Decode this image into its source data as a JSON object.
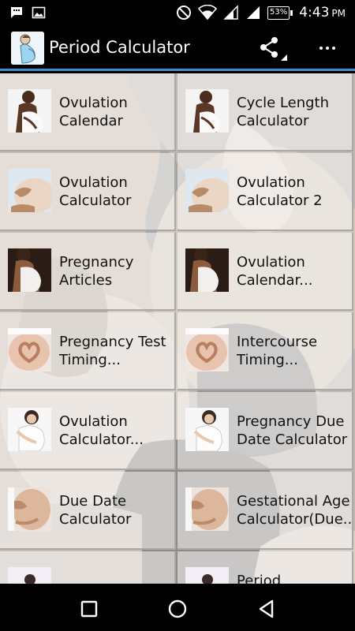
{
  "status_bar": {
    "battery_label": "53%",
    "time": "4:43",
    "ampm": "PM",
    "icons": [
      "message-notification-icon",
      "image-notification-icon",
      "do-not-disturb-icon",
      "wifi-icon",
      "signal-icon",
      "battery-icon"
    ]
  },
  "app_bar": {
    "title": "Period Calculator",
    "icons": [
      "app-logo-icon",
      "share-icon",
      "more-options-icon"
    ]
  },
  "grid": {
    "items": [
      {
        "label": "Ovulation\nCalendar",
        "image": "pregnant-woman-photo"
      },
      {
        "label": "Cycle Length\nCalculator",
        "image": "pregnant-woman-photo"
      },
      {
        "label": "Ovulation\nCalculator",
        "image": "pregnant-belly-photo"
      },
      {
        "label": "Ovulation\nCalculator 2",
        "image": "pregnant-belly-photo"
      },
      {
        "label": "Pregnancy\nArticles",
        "image": "pregnant-woman-dress-photo"
      },
      {
        "label": "Ovulation\nCalendar...",
        "image": "pregnant-woman-dress-photo"
      },
      {
        "label": "Pregnancy Test\nTiming...",
        "image": "heart-hands-belly-photo"
      },
      {
        "label": "Intercourse\nTiming...",
        "image": "heart-hands-belly-photo"
      },
      {
        "label": "Ovulation\nCalculator...",
        "image": "pregnant-woman-smiling-photo"
      },
      {
        "label": "Pregnancy Due\nDate Calculator",
        "image": "pregnant-woman-smiling-photo"
      },
      {
        "label": "Due Date\nCalculator",
        "image": "pregnant-belly-closeup-photo"
      },
      {
        "label": "Gestational Age\nCalculator(Due...",
        "image": "pregnant-belly-closeup-photo"
      },
      {
        "label": "",
        "image": "pregnant-woman-purple-photo"
      },
      {
        "label": "Period",
        "image": "pregnant-woman-purple-photo"
      }
    ]
  },
  "nav_bar": {
    "icons": [
      "recent-apps-icon",
      "home-icon",
      "back-icon"
    ]
  }
}
